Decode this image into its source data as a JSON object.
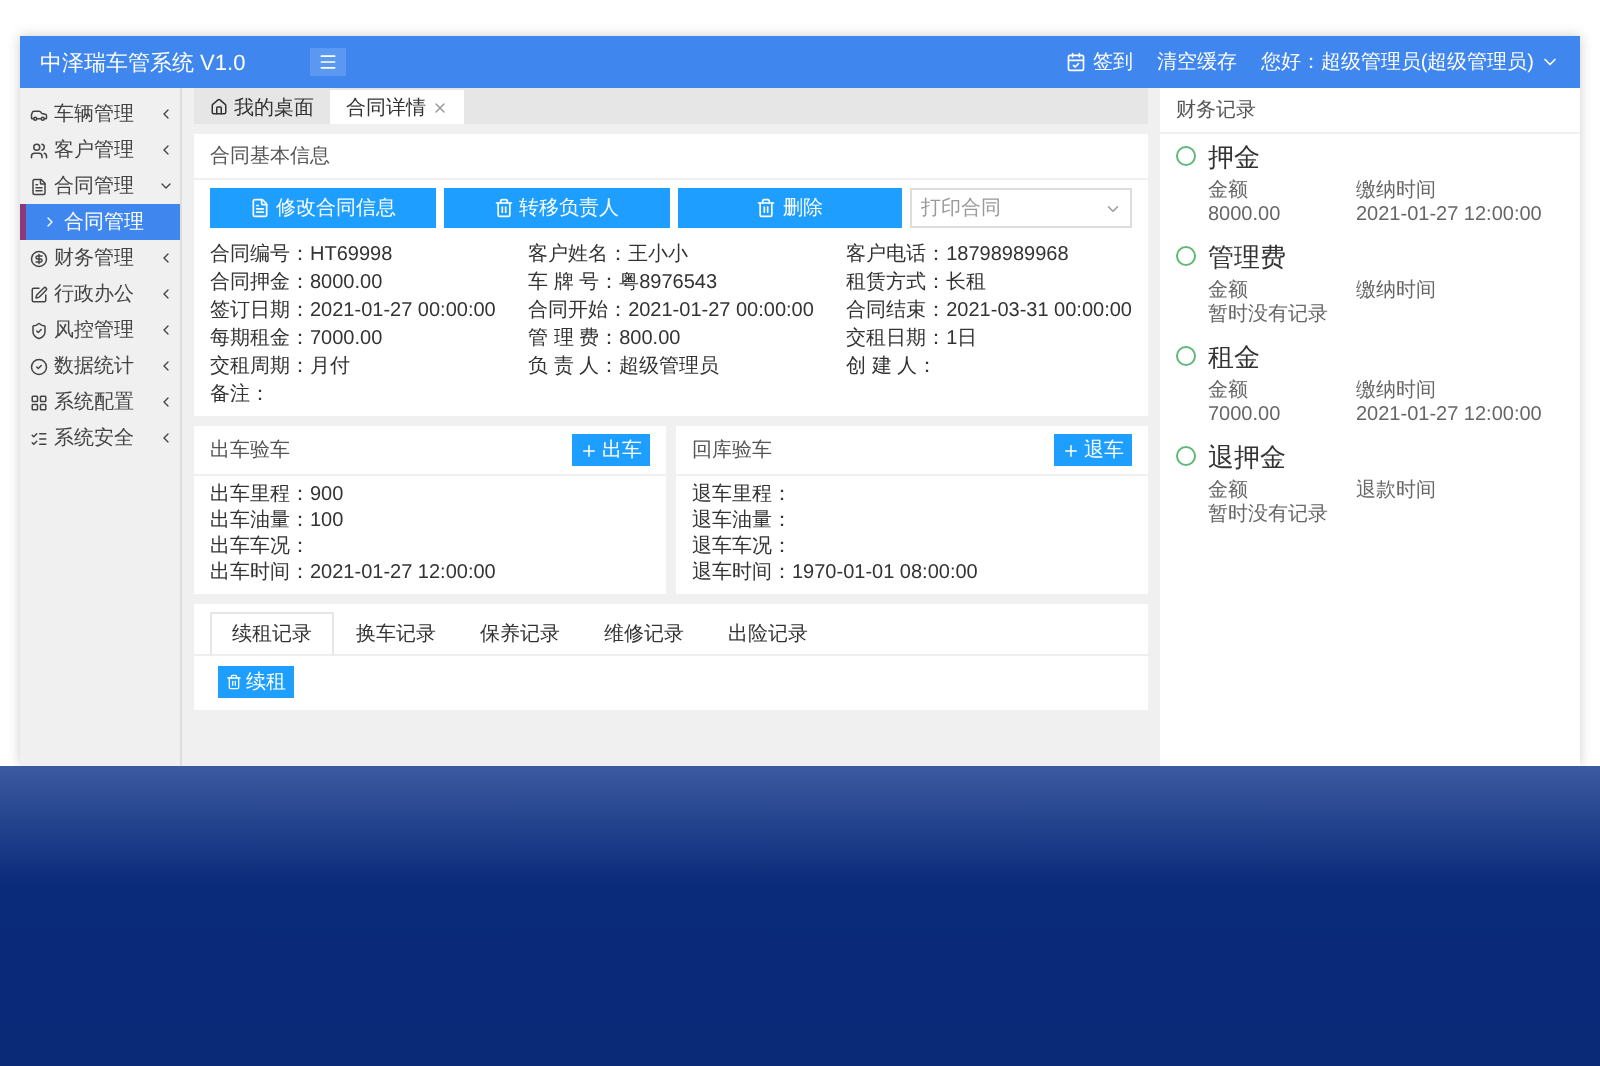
{
  "header": {
    "title": "中泽瑞车管系统 V1.0",
    "actions": [
      {
        "label": "签到"
      },
      {
        "label": "清空缓存"
      }
    ],
    "user": "您好：超级管理员(超级管理员)"
  },
  "sidebar": {
    "items": [
      {
        "label": "车辆管理",
        "expanded": false
      },
      {
        "label": "客户管理",
        "expanded": false
      },
      {
        "label": "合同管理",
        "expanded": true,
        "children": [
          {
            "label": "合同管理",
            "selected": true
          }
        ]
      },
      {
        "label": "财务管理",
        "expanded": false
      },
      {
        "label": "行政办公",
        "expanded": false
      },
      {
        "label": "风控管理",
        "expanded": false
      },
      {
        "label": "数据统计",
        "expanded": false
      },
      {
        "label": "系统配置",
        "expanded": false
      },
      {
        "label": "系统安全",
        "expanded": false
      }
    ]
  },
  "tabs": [
    {
      "label": "我的桌面",
      "selected": false,
      "closable": false
    },
    {
      "label": "合同详情",
      "selected": true,
      "closable": true
    }
  ],
  "contract": {
    "title": "合同基本信息",
    "buttons": [
      {
        "label": "修改合同信息"
      },
      {
        "label": "转移负责人"
      },
      {
        "label": "删除"
      }
    ],
    "print_select": {
      "placeholder": "打印合同"
    },
    "columns": [
      [
        "合同编号：HT69998",
        "合同押金：8000.00",
        "签订日期：2021-01-27 00:00:00",
        "每期租金：7000.00",
        "交租周期：月付"
      ],
      [
        "客户姓名：王小小",
        "车 牌 号：粤8976543",
        "合同开始：2021-01-27 00:00:00",
        "管 理 费：800.00",
        "负 责 人：超级管理员"
      ],
      [
        "客户电话：18798989968",
        "租赁方式：长租",
        "合同结束：2021-03-31 00:00:00",
        "交租日期：1日",
        "创 建 人："
      ]
    ],
    "note": "备注："
  },
  "checks": [
    {
      "title": "出车验车",
      "button": "出车",
      "lines": [
        "出车里程：900",
        "出车油量：100",
        "出车车况：",
        "出车时间：2021-01-27 12:00:00"
      ]
    },
    {
      "title": "回库验车",
      "button": "退车",
      "lines": [
        "退车里程：",
        "退车油量：",
        "退车车况：",
        "退车时间：1970-01-01 08:00:00"
      ]
    }
  ],
  "records": {
    "tabs": [
      {
        "label": "续租记录",
        "selected": true
      },
      {
        "label": "换车记录",
        "selected": false
      },
      {
        "label": "保养记录",
        "selected": false
      },
      {
        "label": "维修记录",
        "selected": false
      },
      {
        "label": "出险记录",
        "selected": false
      }
    ],
    "button": "续租"
  },
  "finance": {
    "title": "财务记录",
    "items": [
      {
        "title": "押金",
        "amount_label": "金额",
        "amount": "8000.00",
        "time_label": "缴纳时间",
        "time": "2021-01-27 12:00:00"
      },
      {
        "title": "管理费",
        "amount_label": "金额",
        "amount": "暂时没有记录",
        "time_label": "缴纳时间"
      },
      {
        "title": "租金",
        "amount_label": "金额",
        "amount": "7000.00",
        "time_label": "缴纳时间",
        "time": "2021-01-27 12:00:00"
      },
      {
        "title": "退押金",
        "amount_label": "金额",
        "amount": "暂时没有记录",
        "time_label": "退款时间"
      }
    ]
  }
}
